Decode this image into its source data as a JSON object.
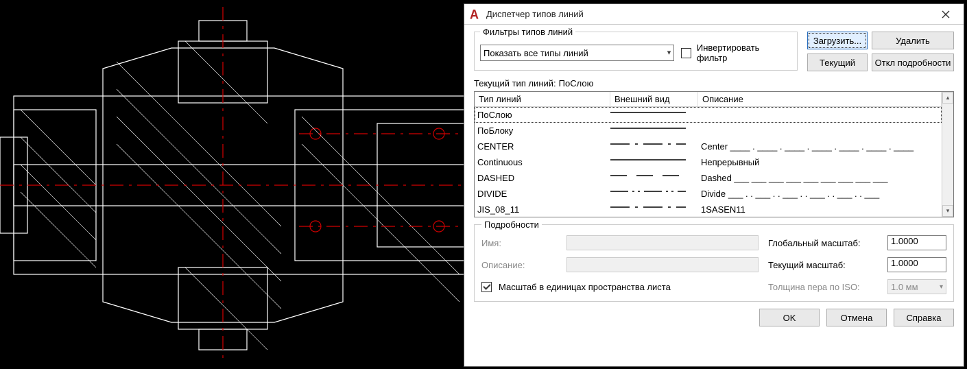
{
  "dialog": {
    "title": "Диспетчер типов линий",
    "filters_legend": "Фильтры типов линий",
    "filter_selected": "Показать все типы линий",
    "invert_filter_label": "Инвертировать фильтр",
    "invert_filter_checked": false,
    "buttons": {
      "load": "Загрузить...",
      "delete": "Удалить",
      "current": "Текущий",
      "details_off": "Откл подробности"
    },
    "current_line_label": "Текущий тип линий:",
    "current_line_value": "ПоСлою"
  },
  "table": {
    "headers": {
      "type": "Тип линий",
      "appearance": "Внешний вид",
      "description": "Описание"
    },
    "rows": [
      {
        "name": "ПоСлою",
        "desc": "",
        "style": "solid"
      },
      {
        "name": "ПоБлоку",
        "desc": "",
        "style": "solid"
      },
      {
        "name": "CENTER",
        "desc": "Center ____ . ____ . ____ . ____ . ____ . ____ . ____",
        "style": "center"
      },
      {
        "name": "Continuous",
        "desc": "Непрерывный",
        "style": "solid"
      },
      {
        "name": "DASHED",
        "desc": "Dashed ___ ___ ___ ___ ___ ___ ___ ___ ___",
        "style": "dashed"
      },
      {
        "name": "DIVIDE",
        "desc": "Divide ___ . . ___ . . ___ . . ___ . . ___ . . ___",
        "style": "divide"
      },
      {
        "name": "JIS_08_11",
        "desc": "1SASEN11",
        "style": "center"
      }
    ]
  },
  "details": {
    "legend": "Подробности",
    "name_label": "Имя:",
    "desc_label": "Описание:",
    "scale_cb_label": "Масштаб в единицах пространства листа",
    "scale_cb_checked": true,
    "global_scale_label": "Глобальный масштаб:",
    "global_scale_value": "1.0000",
    "current_scale_label": "Текущий масштаб:",
    "current_scale_value": "1.0000",
    "iso_pen_label": "Толщина пера по ISO:",
    "iso_pen_value": "1.0 мм"
  },
  "footer": {
    "ok": "OK",
    "cancel": "Отмена",
    "help": "Справка"
  }
}
